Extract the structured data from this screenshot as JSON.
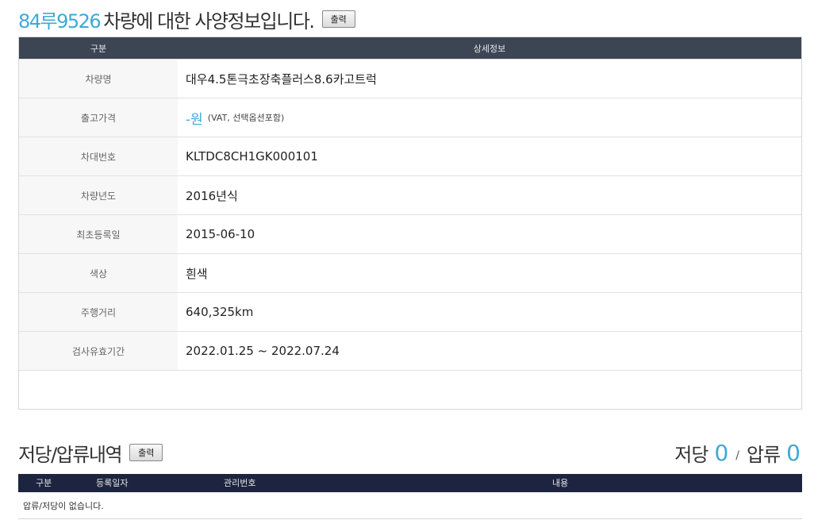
{
  "header": {
    "plate": "84루9526",
    "title_rest": "차량에 대한 사양정보입니다.",
    "print_label": "출력"
  },
  "spec_table": {
    "columns": [
      "구분",
      "상세정보"
    ],
    "rows": [
      {
        "label": "차량명",
        "value": "대우4.5톤극초장축플러스8.6카고트럭"
      },
      {
        "label": "출고가격",
        "value": "-원",
        "note": "(VAT, 선택옵션포함)"
      },
      {
        "label": "차대번호",
        "value": "KLTDC8CH1GK000101"
      },
      {
        "label": "차량년도",
        "value": "2016년식"
      },
      {
        "label": "최초등록일",
        "value": "2015-06-10"
      },
      {
        "label": "색상",
        "value": "흰색"
      },
      {
        "label": "주행거리",
        "value": "640,325km"
      },
      {
        "label": "검사유효기간",
        "value": "2022.01.25 ~ 2022.07.24"
      }
    ]
  },
  "lien_section": {
    "title": "저당/압류내역",
    "print_label": "출력",
    "mortgage_label": "저당",
    "mortgage_count": "0",
    "separator": "/",
    "seizure_label": "압류",
    "seizure_count": "0",
    "columns": [
      "구분",
      "등록일자",
      "관리번호",
      "내용"
    ],
    "empty_message": "압류/저당이 없습니다."
  },
  "colors": {
    "accent": "#3fa9d6",
    "spec_header_bg": "#3c4554",
    "lien_header_bg": "#1c2440"
  }
}
